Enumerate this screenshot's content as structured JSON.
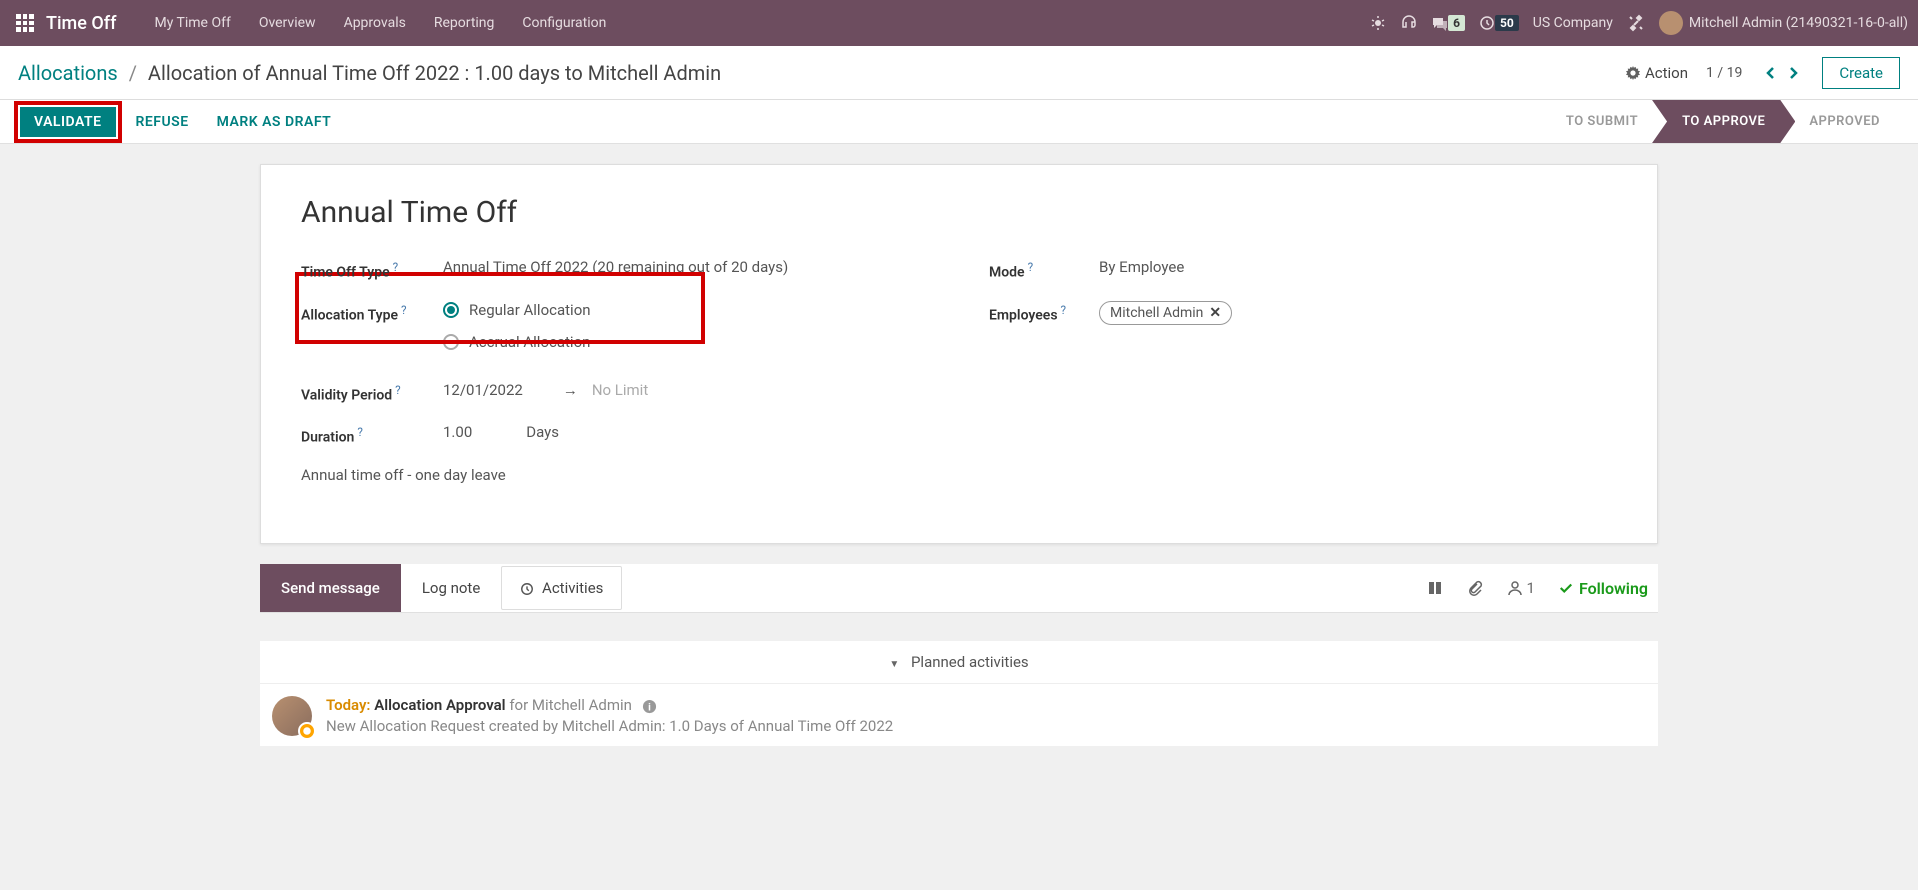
{
  "navbar": {
    "brand": "Time Off",
    "links": [
      "My Time Off",
      "Overview",
      "Approvals",
      "Reporting",
      "Configuration"
    ],
    "msg_count": "6",
    "clock_count": "50",
    "company": "US Company",
    "user": "Mitchell Admin (21490321-16-0-all)"
  },
  "breadcrumb": {
    "root": "Allocations",
    "current": "Allocation of Annual Time Off 2022 : 1.00 days to Mitchell Admin"
  },
  "actionbar": {
    "action": "Action",
    "pager": "1 / 19",
    "create": "Create"
  },
  "buttons": {
    "validate": "VALIDATE",
    "refuse": "REFUSE",
    "draft": "MARK AS DRAFT"
  },
  "status": {
    "submit": "TO SUBMIT",
    "approve": "TO APPROVE",
    "approved": "APPROVED"
  },
  "form": {
    "title": "Annual Time Off",
    "time_off_type_label": "Time Off Type",
    "time_off_type_value": "Annual Time Off 2022 (20 remaining out of 20 days)",
    "allocation_type_label": "Allocation Type",
    "allocation_regular": "Regular Allocation",
    "allocation_accrual": "Accrual Allocation",
    "validity_label": "Validity Period",
    "validity_from": "12/01/2022",
    "validity_to": "No Limit",
    "duration_label": "Duration",
    "duration_value": "1.00",
    "duration_unit": "Days",
    "description": "Annual time off - one day leave",
    "mode_label": "Mode",
    "mode_value": "By Employee",
    "employees_label": "Employees",
    "employee_tag": "Mitchell Admin"
  },
  "chatter": {
    "send": "Send message",
    "lognote": "Log note",
    "activities": "Activities",
    "follower_count": "1",
    "following": "Following",
    "planned": "Planned activities"
  },
  "activity": {
    "today": "Today:",
    "title": "Allocation Approval",
    "for": "for Mitchell Admin",
    "line2": "New Allocation Request created by Mitchell Admin: 1.0 Days of Annual Time Off 2022"
  }
}
